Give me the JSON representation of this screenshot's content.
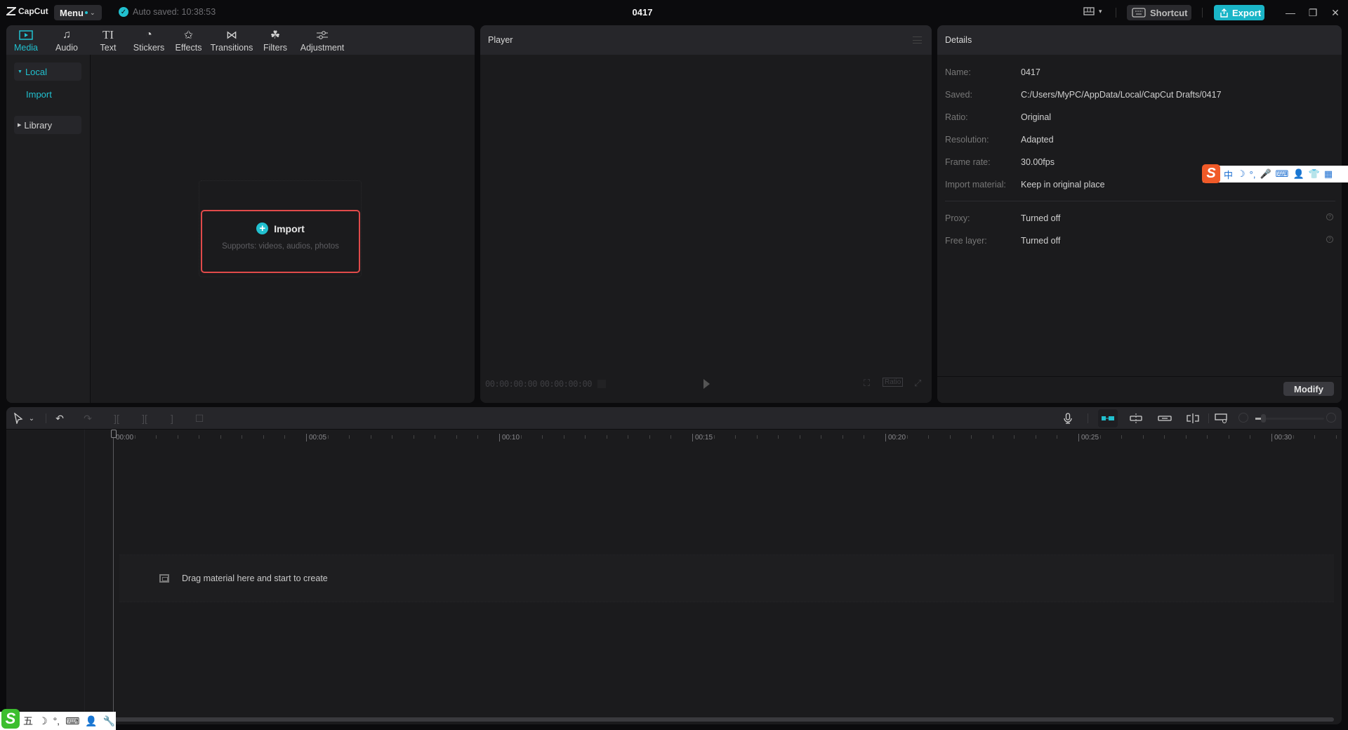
{
  "app": {
    "logo_text": "CapCut",
    "menu_label": "Menu",
    "autosave_text": "Auto saved: 10:38:53",
    "project_title": "0417",
    "shortcut_label": "Shortcut",
    "export_label": "Export",
    "accent_color": "#21c0cf",
    "highlight_border_color": "#e04a4a"
  },
  "media_tabs": [
    {
      "label": "Media",
      "icon": "media-icon",
      "active": true
    },
    {
      "label": "Audio",
      "icon": "audio-icon",
      "active": false
    },
    {
      "label": "Text",
      "icon": "text-icon",
      "active": false
    },
    {
      "label": "Stickers",
      "icon": "sticker-icon",
      "active": false
    },
    {
      "label": "Effects",
      "icon": "effects-icon",
      "active": false
    },
    {
      "label": "Transitions",
      "icon": "transitions-icon",
      "active": false
    },
    {
      "label": "Filters",
      "icon": "filters-icon",
      "active": false
    },
    {
      "label": "Adjustment",
      "icon": "adjustment-icon",
      "active": false
    }
  ],
  "sidebar": {
    "local_label": "Local",
    "import_label": "Import",
    "library_label": "Library"
  },
  "import_card": {
    "title": "Import",
    "subtitle": "Supports: videos, audios, photos"
  },
  "player": {
    "title": "Player",
    "current_time": "00:00:00:00",
    "total_time": "00:00:00:00",
    "ratio_label": "Ratio"
  },
  "details": {
    "title": "Details",
    "rows": [
      {
        "label": "Name:",
        "value": "0417"
      },
      {
        "label": "Saved:",
        "value": "C:/Users/MyPC/AppData/Local/CapCut Drafts/0417"
      },
      {
        "label": "Ratio:",
        "value": "Original"
      },
      {
        "label": "Resolution:",
        "value": "Adapted"
      },
      {
        "label": "Frame rate:",
        "value": "30.00fps"
      },
      {
        "label": "Import material:",
        "value": "Keep in original place"
      }
    ],
    "extra_rows": [
      {
        "label": "Proxy:",
        "value": "Turned off"
      },
      {
        "label": "Free layer:",
        "value": "Turned off"
      }
    ],
    "modify_label": "Modify"
  },
  "timeline": {
    "ruler_labels": [
      "00:00",
      "|00:05",
      "|00:10",
      "|00:15",
      "|00:20",
      "|00:25",
      "|00:30"
    ],
    "drop_hint": "Drag material here and start to create"
  },
  "ime": {
    "top_bar_chars": [
      "中",
      "☽",
      "°,",
      "🎤",
      "⌨",
      "👤",
      "👕",
      "▦"
    ],
    "bottom_bar_chars": [
      "五",
      "☽",
      "°,",
      "⌨",
      "👤",
      "🔧"
    ]
  }
}
